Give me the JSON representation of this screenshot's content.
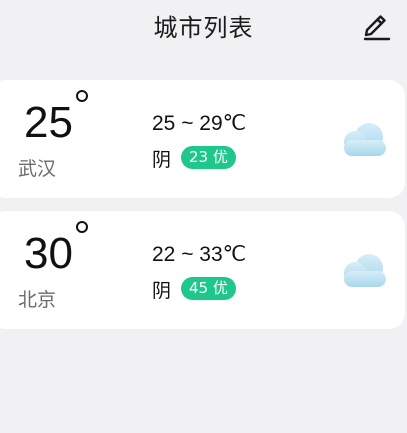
{
  "header": {
    "title": "城市列表",
    "edit_icon": "pencil-edit-icon"
  },
  "cities": [
    {
      "temp": "25",
      "name": "武汉",
      "range": "25 ~ 29℃",
      "condition": "阴",
      "aqi": "23 优",
      "icon": "cloud-icon"
    },
    {
      "temp": "30",
      "name": "北京",
      "range": "22 ~ 33℃",
      "condition": "阴",
      "aqi": "45 优",
      "icon": "cloud-icon"
    }
  ],
  "colors": {
    "background": "#f1f1f3",
    "card": "#ffffff",
    "aqi_good": "#1ec88b",
    "cloud": "#bfe3f3"
  }
}
